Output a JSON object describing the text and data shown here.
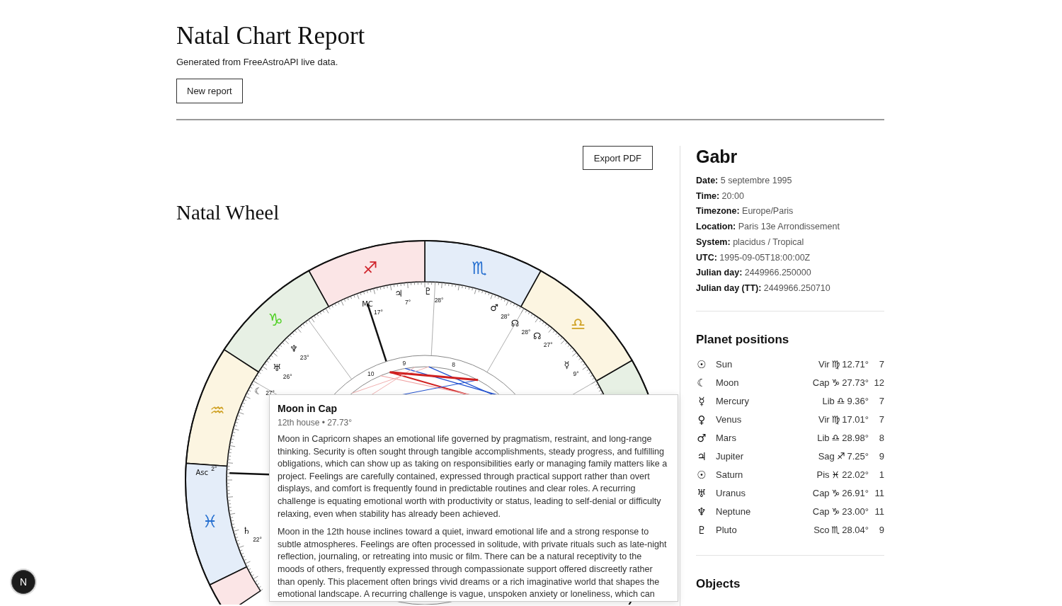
{
  "header": {
    "title": "Natal Chart Report",
    "subtitle": "Generated from FreeAstroAPI live data.",
    "new_report_button": "New report"
  },
  "export_button": "Export PDF",
  "wheel_section": {
    "title": "Natal Wheel",
    "wheel": {
      "signs": [
        {
          "color": "#e7f0e4"
        },
        {
          "glyph": "♎",
          "color": "#fcf5e1"
        },
        {
          "glyph": "♏",
          "color": "#e4edf9"
        },
        {
          "glyph": "♐",
          "color": "#fbe5e6"
        },
        {
          "glyph": "♑",
          "color": "#e7f0e4"
        },
        {
          "glyph": "♒",
          "color": "#fcf5e1"
        },
        {
          "glyph": "♓",
          "color": "#e4edf9"
        },
        {
          "color": "#fbe5e6"
        }
      ],
      "houses": [
        "10",
        "9",
        "8"
      ],
      "markers": [
        {
          "glyph": "MC",
          "degree": "17°"
        },
        {
          "glyph": "♃",
          "degree": "7°"
        },
        {
          "glyph": "♇",
          "degree": "28°"
        },
        {
          "glyph": "♂",
          "degree": "28°"
        },
        {
          "glyph": "☊",
          "degree": "28°"
        },
        {
          "glyph": "☊",
          "degree": "27°"
        },
        {
          "glyph": "☿",
          "degree": "9°"
        },
        {
          "glyph": "♆",
          "degree": "23°"
        },
        {
          "glyph": "♅",
          "degree": "26°"
        },
        {
          "glyph": "☾",
          "degree": "27°"
        },
        {
          "glyph": "Asc",
          "degree": "2°"
        },
        {
          "glyph": "♄",
          "degree": "22°"
        }
      ]
    },
    "tooltip": {
      "title": "Moon in Cap",
      "subtitle": "12th house • 27.73°",
      "paragraphs": [
        "Moon in Capricorn shapes an emotional life governed by pragmatism, restraint, and long-range thinking. Security is often sought through tangible accomplishments, steady progress, and fulfilling obligations, which can show up as taking on responsibilities early or managing family matters like a project. Feelings are carefully contained, expressed through practical support rather than overt displays, and comfort is frequently found in predictable routines and clear roles. A recurring challenge is equating emotional worth with productivity or status, leading to self-denial or difficulty relaxing, even when stability has already been achieved.",
        "Moon in the 12th house inclines toward a quiet, inward emotional life and a strong response to subtle atmospheres. Feelings are often processed in solitude, with private rituals such as late-night reflection, journaling, or retreating into music or film. There can be a natural receptivity to the moods of others, frequently expressed through compassionate support offered discreetly rather than openly. This placement often brings vivid dreams or a rich imaginative world that shapes the emotional landscape. A recurring challenge is vague, unspoken anxiety or loneliness, which can"
      ]
    }
  },
  "profile": {
    "name": "Gabr",
    "facts": [
      {
        "label": "Date:",
        "value": "5 septembre 1995"
      },
      {
        "label": "Time:",
        "value": "20:00"
      },
      {
        "label": "Timezone:",
        "value": "Europe/Paris"
      },
      {
        "label": "Location:",
        "value": "Paris 13e Arrondissement"
      },
      {
        "label": "System:",
        "value": "placidus / Tropical"
      },
      {
        "label": "UTC:",
        "value": "1995-09-05T18:00:00Z"
      },
      {
        "label": "Julian day:",
        "value": "2449966.250000"
      },
      {
        "label": "Julian day (TT):",
        "value": "2449966.250710"
      }
    ]
  },
  "planet_positions": {
    "title": "Planet positions",
    "rows": [
      {
        "symbol": "☉",
        "name": "Sun",
        "sign": "Vir",
        "sign_glyph": "♍",
        "degree": "12.71°",
        "house": "7"
      },
      {
        "symbol": "☾",
        "name": "Moon",
        "sign": "Cap",
        "sign_glyph": "♑",
        "degree": "27.73°",
        "house": "12"
      },
      {
        "symbol": "☿",
        "name": "Mercury",
        "sign": "Lib",
        "sign_glyph": "♎",
        "degree": "9.36°",
        "house": "7"
      },
      {
        "symbol": "♀",
        "name": "Venus",
        "sign": "Vir",
        "sign_glyph": "♍",
        "degree": "17.01°",
        "house": "7"
      },
      {
        "symbol": "♂",
        "name": "Mars",
        "sign": "Lib",
        "sign_glyph": "♎",
        "degree": "28.98°",
        "house": "8"
      },
      {
        "symbol": "♃",
        "name": "Jupiter",
        "sign": "Sag",
        "sign_glyph": "♐",
        "degree": "7.25°",
        "house": "9"
      },
      {
        "symbol": "☉",
        "name": "Saturn",
        "sign": "Pis",
        "sign_glyph": "♓",
        "degree": "22.02°",
        "house": "1"
      },
      {
        "symbol": "♅",
        "name": "Uranus",
        "sign": "Cap",
        "sign_glyph": "♑",
        "degree": "26.91°",
        "house": "11"
      },
      {
        "symbol": "♆",
        "name": "Neptune",
        "sign": "Cap",
        "sign_glyph": "♑",
        "degree": "23.00°",
        "house": "11"
      },
      {
        "symbol": "♇",
        "name": "Pluto",
        "sign": "Sco",
        "sign_glyph": "♏",
        "degree": "28.04°",
        "house": "9"
      }
    ]
  },
  "objects": {
    "title": "Objects"
  },
  "dev_badge": "N"
}
